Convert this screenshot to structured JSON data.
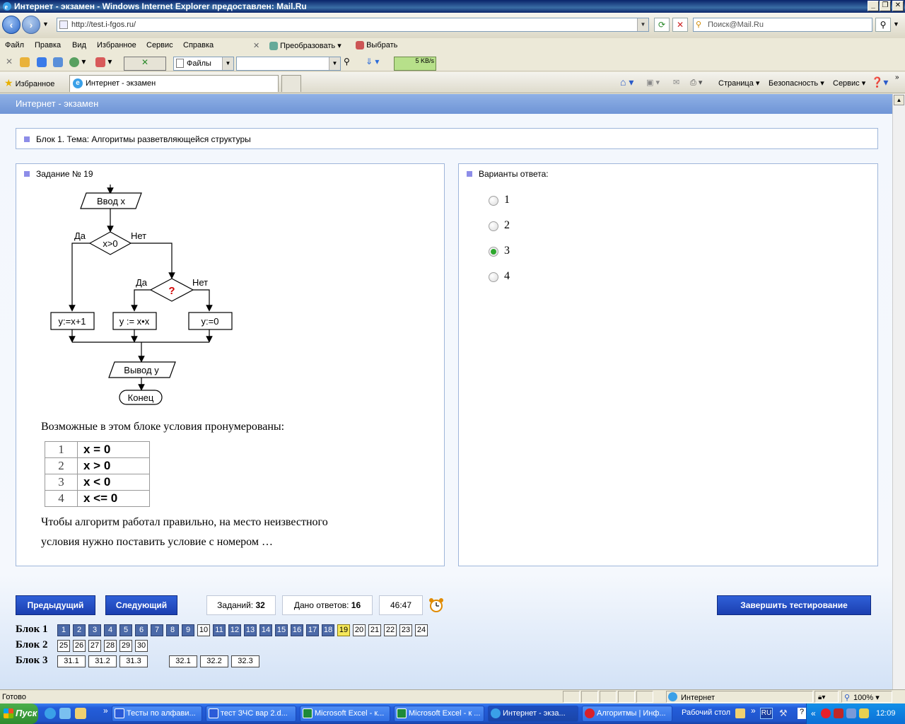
{
  "window": {
    "title": "Интернет - экзамен - Windows Internet Explorer предоставлен: Mail.Ru"
  },
  "address": {
    "url": "http://test.i-fgos.ru/",
    "search_placeholder": "Поиск@Mail.Ru"
  },
  "menu": {
    "items": [
      "Файл",
      "Правка",
      "Вид",
      "Избранное",
      "Сервис",
      "Справка"
    ],
    "convert": "Преобразовать",
    "select": "Выбрать"
  },
  "toolbar": {
    "files": "Файлы",
    "speed": "5 KB/s"
  },
  "tabs": {
    "favorites": "Избранное",
    "tab_title": "Интернет - экзамен",
    "page_cmd": "Страница",
    "security_cmd": "Безопасность",
    "service_cmd": "Сервис"
  },
  "page": {
    "header": "Интернет - экзамен",
    "block_title": "Блок 1. Тема: Алгоритмы разветвляющейся структуры",
    "task_title": "Задание № 19",
    "answers_title": "Варианты ответа:"
  },
  "flowchart": {
    "input": "Ввод x",
    "cond1": "x>0",
    "yes1": "Да",
    "no1": "Нет",
    "cond2": "?",
    "yes2": "Да",
    "no2": "Нет",
    "box1": "y:=x+1",
    "box2": "y := x•x",
    "box3": "y:=0",
    "output": "Вывод  y",
    "end": "Конец"
  },
  "question": {
    "intro": "Возможные в этом блоке условия пронумерованы:",
    "conditions": [
      {
        "n": "1",
        "c": "x = 0"
      },
      {
        "n": "2",
        "c": "x > 0"
      },
      {
        "n": "3",
        "c": "x < 0"
      },
      {
        "n": "4",
        "c": "x <= 0"
      }
    ],
    "text_line1": "Чтобы алгоритм работал правильно, на место неизвестного",
    "text_line2": "условия нужно поставить условие с номером …"
  },
  "answers": [
    {
      "label": "1",
      "selected": false
    },
    {
      "label": "2",
      "selected": false
    },
    {
      "label": "3",
      "selected": true
    },
    {
      "label": "4",
      "selected": false
    }
  ],
  "controls": {
    "prev": "Предыдущий",
    "next": "Следующий",
    "tasks_label": "Заданий:",
    "tasks_count": "32",
    "answered_label": "Дано ответов:",
    "answered_count": "16",
    "timer": "46:47",
    "finish": "Завершить тестирование"
  },
  "blocks": [
    {
      "label": "Блок 1",
      "items": [
        "1",
        "2",
        "3",
        "4",
        "5",
        "6",
        "7",
        "8",
        "9",
        "10",
        "11",
        "12",
        "13",
        "14",
        "15",
        "16",
        "17",
        "18",
        "19",
        "20",
        "21",
        "22",
        "23",
        "24"
      ]
    },
    {
      "label": "Блок 2",
      "items": [
        "25",
        "26",
        "27",
        "28",
        "29",
        "30"
      ]
    },
    {
      "label": "Блок 3",
      "items": [
        "31.1",
        "31.2",
        "31.3",
        "32.1",
        "32.2",
        "32.3"
      ]
    }
  ],
  "block_state": {
    "done": [
      "1",
      "2",
      "3",
      "4",
      "5",
      "6",
      "7",
      "8",
      "9",
      "11",
      "12",
      "13",
      "14",
      "15",
      "16",
      "17",
      "18"
    ],
    "current": "19"
  },
  "status": {
    "ready": "Готово",
    "zone": "Интернет",
    "zoom": "100%"
  },
  "taskbar": {
    "start": "Пуск",
    "tasks": [
      "Тесты по алфави...",
      "тест ЗЧС вар 2.d...",
      "Microsoft Excel - к...",
      "Microsoft Excel - к ...",
      "Интернет - экза...",
      "Алгоритмы | Инф..."
    ],
    "desktop": "Рабочий стол",
    "lang": "RU",
    "clock": "12:09"
  },
  "colors": {
    "header_blue": "#7a9fdc",
    "button_blue": "#2347c0",
    "done_box": "#4c6aa8",
    "current_box": "#f5e85a",
    "radio_selected": "#2ea82e"
  }
}
